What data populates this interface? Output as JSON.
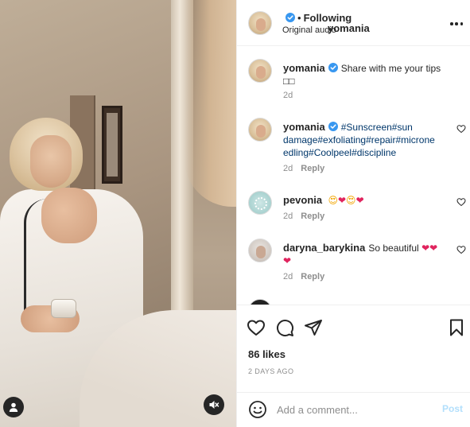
{
  "post": {
    "username": "yomania",
    "following_label": "Following",
    "subtitle": "Original audio"
  },
  "comments": [
    {
      "username": "yomania",
      "text": "Share with me your tips",
      "trailing": "□□",
      "age": "2d",
      "reply_label": ""
    },
    {
      "username": "yomania",
      "tags": [
        "#Sunscreen",
        "#sun damage",
        "#exfoliating",
        "#repair",
        "#microne edling",
        "#Coolpeel",
        "#discipline"
      ],
      "age": "2d",
      "reply_label": "Reply"
    },
    {
      "username": "pevonia",
      "emojis": [
        "😍",
        "❤",
        "😍",
        "❤"
      ],
      "age": "2d",
      "reply_label": "Reply"
    },
    {
      "username": "daryna_barykina",
      "text": "So beautiful",
      "emojis": [
        "❤",
        "❤",
        "❤"
      ],
      "age": "2d",
      "reply_label": "Reply"
    }
  ],
  "actions": {
    "likes": "86 likes",
    "posted_ago": "2 DAYS AGO"
  },
  "add_comment": {
    "placeholder": "Add a comment...",
    "post_label": "Post"
  },
  "colors": {
    "link": "#00376b",
    "heart": "#e0245e",
    "verified": "#3897f0",
    "muted": "#8e8e8e"
  },
  "icons": {
    "verified": "verified-badge-icon",
    "more": "more-options-icon",
    "like": "heart-icon",
    "comment": "comment-bubble-icon",
    "share": "paper-plane-icon",
    "save": "bookmark-icon",
    "emoji": "smiley-icon",
    "user": "user-tag-icon",
    "mute": "speaker-muted-icon"
  }
}
